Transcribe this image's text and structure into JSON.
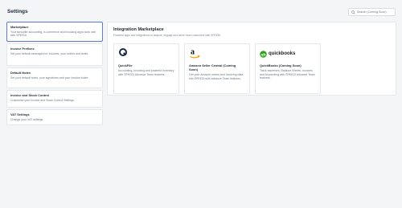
{
  "header": {
    "title": "Settings",
    "search_placeholder": "Search (Coming Soon)"
  },
  "sidebar": {
    "items": [
      {
        "title": "Marketplace",
        "desc": "Your favourite accounting, e-commerce and invoicing apps work well with SPEEDI.",
        "active": true
      },
      {
        "title": "Invoice Prefixes",
        "desc": "Set your default messages for Invoices, your orders and notes."
      },
      {
        "title": "Default Notes",
        "desc": "Set your default notes, your signatures and your Invoice footer."
      },
      {
        "title": "Invoice and Stock Control",
        "desc": "Customise your Invoice and Stock Control Settings."
      },
      {
        "title": "VAT Settings",
        "desc": "Change your VAT settings."
      }
    ]
  },
  "main": {
    "title": "Integration Marketplace",
    "subtitle": "Powerful apps and integrations to acquire, engage and serve more customers with SPEEDI.",
    "cards": [
      {
        "name": "QuickFile",
        "desc": "Accounting, Invoicing and powerful Inventory with SPEEDI Advance Team features.",
        "logo": "quickfile-logo"
      },
      {
        "name": "Amazon Seller Central (Coming Soon)",
        "desc": "Get your Amazon orders and Invoicing data into SPEEDI with advance Team features.",
        "logo": "amazon-logo"
      },
      {
        "name": "QuickBooks (Coming Soon)",
        "desc": "Track expenses, Balance Sheets, Invoices and Accounting with SPEEDI Advance Team features.",
        "logo": "quickbooks-logo",
        "logo_text": "quickbooks"
      }
    ]
  },
  "colors": {
    "active_border": "#5b7bd5",
    "quickbooks_green": "#2ca01c",
    "amazon_orange": "#ff9900"
  }
}
